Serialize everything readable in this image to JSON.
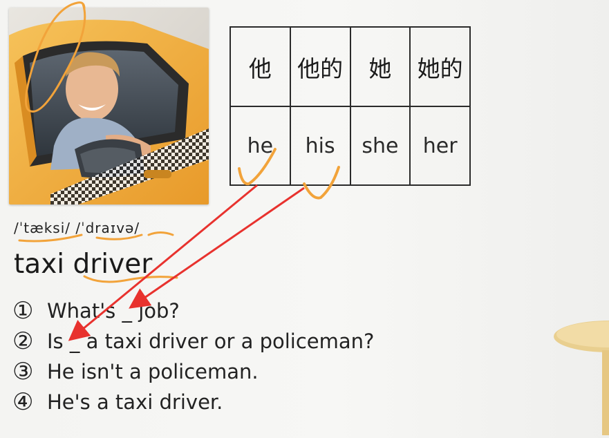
{
  "table": {
    "chinese": [
      "他",
      "他的",
      "她",
      "她的"
    ],
    "english": [
      "he",
      "his",
      "she",
      "her"
    ]
  },
  "vocab": {
    "phonetic": "/ˈtæksi/ /ˈdraɪvə/",
    "word": "taxi driver"
  },
  "sentences": [
    {
      "num": "①",
      "text": "What's _ job?"
    },
    {
      "num": "②",
      "text": "Is _ a taxi driver or a policeman?"
    },
    {
      "num": "③",
      "text": "He isn't a policeman."
    },
    {
      "num": "④",
      "text": "He's a taxi driver."
    }
  ],
  "colors": {
    "annotation_orange": "#f2a33a",
    "arrow_red": "#e8322e",
    "taxi_yellow": "#f3b548"
  }
}
